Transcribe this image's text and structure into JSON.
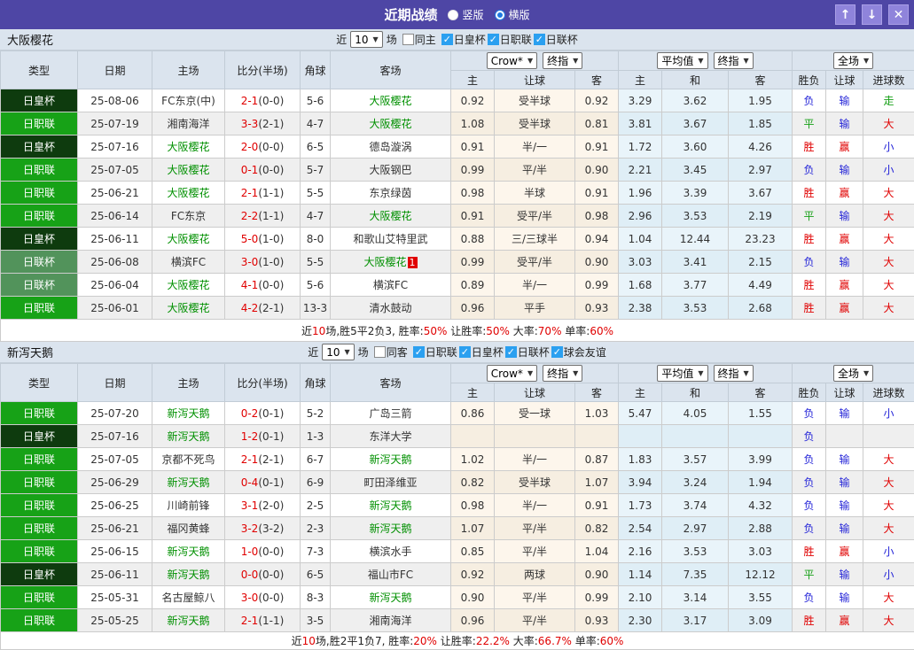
{
  "window": {
    "title": "近期战绩",
    "view_modes": [
      {
        "label": "竖版",
        "selected": false
      },
      {
        "label": "横版",
        "selected": true
      }
    ],
    "buttons": {
      "up": "↑",
      "down": "↓",
      "close": "✕"
    }
  },
  "filter_labels": {
    "near": "近",
    "games": "场"
  },
  "selects": {
    "matches": "10",
    "crow": "Crow*",
    "final1": "终指",
    "avg": "平均值",
    "final2": "终指",
    "full": "全场"
  },
  "columns": {
    "type": "类型",
    "date": "日期",
    "home": "主场",
    "score": "比分(半场)",
    "corner": "角球",
    "away": "客场",
    "h": "主",
    "handicap": "让球",
    "a": "客",
    "eh": "主",
    "draw": "和",
    "ea": "客",
    "outcome": "胜负",
    "handicap_result": "让球",
    "goals": "进球数"
  },
  "type_colors": {
    "日皇杯": "#0e3b0e",
    "日职联": "#17a217",
    "日联杯": "#52935b"
  },
  "result_colors": {
    "胜": "#e00000",
    "平": "#18a018",
    "负": "#2525d8",
    "赢": "#e00000",
    "输": "#2525d8",
    "走": "#18a018",
    "大": "#e00000",
    "小": "#2525d8"
  },
  "sections": [
    {
      "team": "大阪樱花",
      "filter": {
        "same_label": "同主",
        "same_checked": false,
        "leagues": [
          "日皇杯",
          "日职联",
          "日联杯"
        ]
      },
      "rows": [
        {
          "type": "日皇杯",
          "date": "25-08-06",
          "home": "FC东京(中)",
          "home_focus": false,
          "score": "2-1",
          "half": "(0-0)",
          "corner": "5-6",
          "away": "大阪樱花",
          "away_focus": true,
          "badge": "",
          "ch": "0.92",
          "hcap": "受半球",
          "ca": "0.92",
          "eh": "3.29",
          "ed": "3.62",
          "ea": "1.95",
          "r1": "负",
          "r2": "输",
          "r3": "走"
        },
        {
          "type": "日职联",
          "date": "25-07-19",
          "home": "湘南海洋",
          "home_focus": false,
          "score": "3-3",
          "half": "(2-1)",
          "corner": "4-7",
          "away": "大阪樱花",
          "away_focus": true,
          "badge": "",
          "ch": "1.08",
          "hcap": "受半球",
          "ca": "0.81",
          "eh": "3.81",
          "ed": "3.67",
          "ea": "1.85",
          "r1": "平",
          "r2": "输",
          "r3": "大"
        },
        {
          "type": "日皇杯",
          "date": "25-07-16",
          "home": "大阪樱花",
          "home_focus": true,
          "score": "2-0",
          "half": "(0-0)",
          "corner": "6-5",
          "away": "德岛漩涡",
          "away_focus": false,
          "badge": "",
          "ch": "0.91",
          "hcap": "半/一",
          "ca": "0.91",
          "eh": "1.72",
          "ed": "3.60",
          "ea": "4.26",
          "r1": "胜",
          "r2": "赢",
          "r3": "小"
        },
        {
          "type": "日职联",
          "date": "25-07-05",
          "home": "大阪樱花",
          "home_focus": true,
          "score": "0-1",
          "half": "(0-0)",
          "corner": "5-7",
          "away": "大阪钢巴",
          "away_focus": false,
          "badge": "",
          "ch": "0.99",
          "hcap": "平/半",
          "ca": "0.90",
          "eh": "2.21",
          "ed": "3.45",
          "ea": "2.97",
          "r1": "负",
          "r2": "输",
          "r3": "小"
        },
        {
          "type": "日职联",
          "date": "25-06-21",
          "home": "大阪樱花",
          "home_focus": true,
          "score": "2-1",
          "half": "(1-1)",
          "corner": "5-5",
          "away": "东京绿茵",
          "away_focus": false,
          "badge": "",
          "ch": "0.98",
          "hcap": "半球",
          "ca": "0.91",
          "eh": "1.96",
          "ed": "3.39",
          "ea": "3.67",
          "r1": "胜",
          "r2": "赢",
          "r3": "大"
        },
        {
          "type": "日职联",
          "date": "25-06-14",
          "home": "FC东京",
          "home_focus": false,
          "score": "2-2",
          "half": "(1-1)",
          "corner": "4-7",
          "away": "大阪樱花",
          "away_focus": true,
          "badge": "",
          "ch": "0.91",
          "hcap": "受平/半",
          "ca": "0.98",
          "eh": "2.96",
          "ed": "3.53",
          "ea": "2.19",
          "r1": "平",
          "r2": "输",
          "r3": "大"
        },
        {
          "type": "日皇杯",
          "date": "25-06-11",
          "home": "大阪樱花",
          "home_focus": true,
          "score": "5-0",
          "half": "(1-0)",
          "corner": "8-0",
          "away": "和歌山艾特里武",
          "away_focus": false,
          "badge": "",
          "ch": "0.88",
          "hcap": "三/三球半",
          "ca": "0.94",
          "eh": "1.04",
          "ed": "12.44",
          "ea": "23.23",
          "r1": "胜",
          "r2": "赢",
          "r3": "大"
        },
        {
          "type": "日联杯",
          "date": "25-06-08",
          "home": "横滨FC",
          "home_focus": false,
          "score": "3-0",
          "half": "(1-0)",
          "corner": "5-5",
          "away": "大阪樱花",
          "away_focus": true,
          "badge": "1",
          "ch": "0.99",
          "hcap": "受平/半",
          "ca": "0.90",
          "eh": "3.03",
          "ed": "3.41",
          "ea": "2.15",
          "r1": "负",
          "r2": "输",
          "r3": "大"
        },
        {
          "type": "日联杯",
          "date": "25-06-04",
          "home": "大阪樱花",
          "home_focus": true,
          "score": "4-1",
          "half": "(0-0)",
          "corner": "5-6",
          "away": "横滨FC",
          "away_focus": false,
          "badge": "",
          "ch": "0.89",
          "hcap": "半/一",
          "ca": "0.99",
          "eh": "1.68",
          "ed": "3.77",
          "ea": "4.49",
          "r1": "胜",
          "r2": "赢",
          "r3": "大"
        },
        {
          "type": "日职联",
          "date": "25-06-01",
          "home": "大阪樱花",
          "home_focus": true,
          "score": "4-2",
          "half": "(2-1)",
          "corner": "13-3",
          "away": "清水鼓动",
          "away_focus": false,
          "badge": "",
          "ch": "0.96",
          "hcap": "平手",
          "ca": "0.93",
          "eh": "2.38",
          "ed": "3.53",
          "ea": "2.68",
          "r1": "胜",
          "r2": "赢",
          "r3": "大"
        }
      ],
      "summary": [
        {
          "t": "近"
        },
        {
          "t": "10",
          "red": true
        },
        {
          "t": "场,胜5平2负3, 胜率:"
        },
        {
          "t": "50%",
          "red": true
        },
        {
          "t": " 让胜率:"
        },
        {
          "t": "50%",
          "red": true
        },
        {
          "t": " 大率:"
        },
        {
          "t": "70%",
          "red": true
        },
        {
          "t": " 单率:"
        },
        {
          "t": "60%",
          "red": true
        }
      ]
    },
    {
      "team": "新泻天鹅",
      "filter": {
        "same_label": "同客",
        "same_checked": false,
        "leagues": [
          "日职联",
          "日皇杯",
          "日联杯",
          "球会友谊"
        ]
      },
      "rows": [
        {
          "type": "日职联",
          "date": "25-07-20",
          "home": "新泻天鹅",
          "home_focus": true,
          "score": "0-2",
          "half": "(0-1)",
          "corner": "5-2",
          "away": "广岛三箭",
          "away_focus": false,
          "badge": "",
          "ch": "0.86",
          "hcap": "受一球",
          "ca": "1.03",
          "eh": "5.47",
          "ed": "4.05",
          "ea": "1.55",
          "r1": "负",
          "r2": "输",
          "r3": "小"
        },
        {
          "type": "日皇杯",
          "date": "25-07-16",
          "home": "新泻天鹅",
          "home_focus": true,
          "score": "1-2",
          "half": "(0-1)",
          "corner": "1-3",
          "away": "东洋大学",
          "away_focus": false,
          "badge": "",
          "ch": "",
          "hcap": "",
          "ca": "",
          "eh": "",
          "ed": "",
          "ea": "",
          "r1": "负",
          "r2": "",
          "r3": ""
        },
        {
          "type": "日职联",
          "date": "25-07-05",
          "home": "京都不死鸟",
          "home_focus": false,
          "score": "2-1",
          "half": "(2-1)",
          "corner": "6-7",
          "away": "新泻天鹅",
          "away_focus": true,
          "badge": "",
          "ch": "1.02",
          "hcap": "半/一",
          "ca": "0.87",
          "eh": "1.83",
          "ed": "3.57",
          "ea": "3.99",
          "r1": "负",
          "r2": "输",
          "r3": "大"
        },
        {
          "type": "日职联",
          "date": "25-06-29",
          "home": "新泻天鹅",
          "home_focus": true,
          "score": "0-4",
          "half": "(0-1)",
          "corner": "6-9",
          "away": "町田泽维亚",
          "away_focus": false,
          "badge": "",
          "ch": "0.82",
          "hcap": "受半球",
          "ca": "1.07",
          "eh": "3.94",
          "ed": "3.24",
          "ea": "1.94",
          "r1": "负",
          "r2": "输",
          "r3": "大"
        },
        {
          "type": "日职联",
          "date": "25-06-25",
          "home": "川崎前锋",
          "home_focus": false,
          "score": "3-1",
          "half": "(2-0)",
          "corner": "2-5",
          "away": "新泻天鹅",
          "away_focus": true,
          "badge": "",
          "ch": "0.98",
          "hcap": "半/一",
          "ca": "0.91",
          "eh": "1.73",
          "ed": "3.74",
          "ea": "4.32",
          "r1": "负",
          "r2": "输",
          "r3": "大"
        },
        {
          "type": "日职联",
          "date": "25-06-21",
          "home": "福冈黄蜂",
          "home_focus": false,
          "score": "3-2",
          "half": "(3-2)",
          "corner": "2-3",
          "away": "新泻天鹅",
          "away_focus": true,
          "badge": "",
          "ch": "1.07",
          "hcap": "平/半",
          "ca": "0.82",
          "eh": "2.54",
          "ed": "2.97",
          "ea": "2.88",
          "r1": "负",
          "r2": "输",
          "r3": "大"
        },
        {
          "type": "日职联",
          "date": "25-06-15",
          "home": "新泻天鹅",
          "home_focus": true,
          "score": "1-0",
          "half": "(0-0)",
          "corner": "7-3",
          "away": "横滨水手",
          "away_focus": false,
          "badge": "",
          "ch": "0.85",
          "hcap": "平/半",
          "ca": "1.04",
          "eh": "2.16",
          "ed": "3.53",
          "ea": "3.03",
          "r1": "胜",
          "r2": "赢",
          "r3": "小"
        },
        {
          "type": "日皇杯",
          "date": "25-06-11",
          "home": "新泻天鹅",
          "home_focus": true,
          "score": "0-0",
          "half": "(0-0)",
          "corner": "6-5",
          "away": "福山市FC",
          "away_focus": false,
          "badge": "",
          "ch": "0.92",
          "hcap": "两球",
          "ca": "0.90",
          "eh": "1.14",
          "ed": "7.35",
          "ea": "12.12",
          "r1": "平",
          "r2": "输",
          "r3": "小"
        },
        {
          "type": "日职联",
          "date": "25-05-31",
          "home": "名古屋鲸八",
          "home_focus": false,
          "score": "3-0",
          "half": "(0-0)",
          "corner": "8-3",
          "away": "新泻天鹅",
          "away_focus": true,
          "badge": "",
          "ch": "0.90",
          "hcap": "平/半",
          "ca": "0.99",
          "eh": "2.10",
          "ed": "3.14",
          "ea": "3.55",
          "r1": "负",
          "r2": "输",
          "r3": "大"
        },
        {
          "type": "日职联",
          "date": "25-05-25",
          "home": "新泻天鹅",
          "home_focus": true,
          "score": "2-1",
          "half": "(1-1)",
          "corner": "3-5",
          "away": "湘南海洋",
          "away_focus": false,
          "badge": "",
          "ch": "0.96",
          "hcap": "平/半",
          "ca": "0.93",
          "eh": "2.30",
          "ed": "3.17",
          "ea": "3.09",
          "r1": "胜",
          "r2": "赢",
          "r3": "大"
        }
      ],
      "summary": [
        {
          "t": "近"
        },
        {
          "t": "10",
          "red": true
        },
        {
          "t": "场,胜2平1负7, 胜率:"
        },
        {
          "t": "20%",
          "red": true
        },
        {
          "t": " 让胜率:"
        },
        {
          "t": "22.2%",
          "red": true
        },
        {
          "t": " 大率:"
        },
        {
          "t": "66.7%",
          "red": true
        },
        {
          "t": " 单率:"
        },
        {
          "t": "60%",
          "red": true
        }
      ]
    }
  ]
}
